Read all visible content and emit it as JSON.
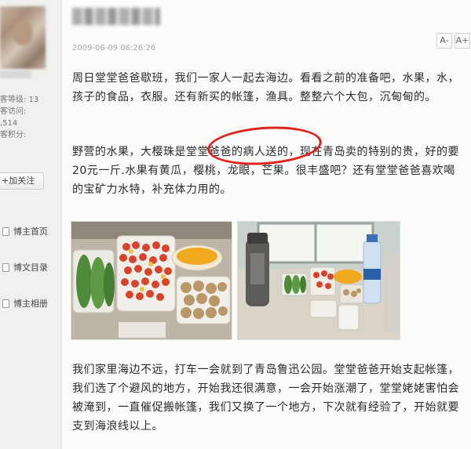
{
  "sidebar": {
    "stats": [
      "客等级: 13",
      "客访问:",
      ",514",
      "客积分:"
    ],
    "follow_label": "+加关注",
    "links": [
      {
        "label": "博主首页",
        "icon": "page-icon"
      },
      {
        "label": "博文目录",
        "icon": "list-icon"
      },
      {
        "label": "博主相册",
        "icon": "photo-icon"
      }
    ]
  },
  "post": {
    "date": "2009-06-09 06:26:26",
    "font_buttons": [
      "A-",
      "A+"
    ],
    "paragraphs": [
      "周日堂堂爸爸歇班，我们一家人一起去海边。看看之前的准备吧，水果，水，孩子的食品，衣服。还有新买的帐篷，渔具。整整六个大包，沉甸甸的。",
      "野营的水果，大樱珠是堂堂爸爸的病人送的，现在青岛卖的特别的贵，好的要20元一斤.水果有黄瓜，樱桃，龙眼，芒果。很丰盛吧？还有堂堂爸爸喜欢喝的宝矿力水特，补充体力用的。",
      "我们家里海边不远，打车一会就到了青岛鲁迅公园。堂堂爸爸开始支起帐篷，我们选了个避风的地方，开始我还很满意，一会开始涨潮了，堂堂姥姥害怕会被淹到，一直催促搬帐篷，我们又换了一个地方，下次就有经验了，开始就要支到海浪线以上。"
    ]
  },
  "colors": {
    "annotation": "#e0211c",
    "page_bg": "#fcfcfa"
  }
}
